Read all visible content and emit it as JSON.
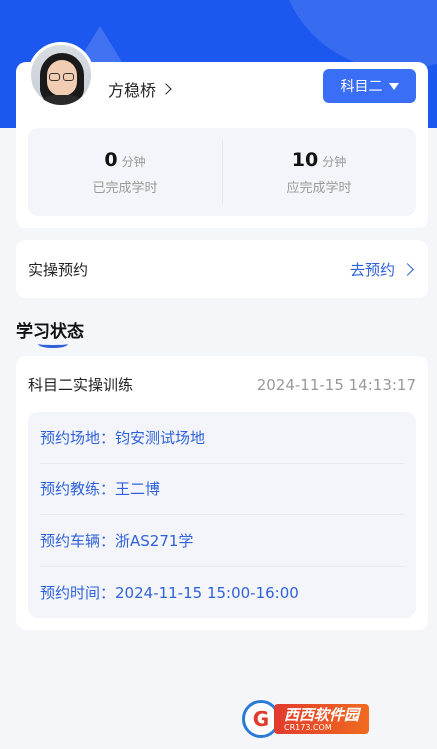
{
  "profile": {
    "name": "方稳桥",
    "subject_button": "科目二"
  },
  "stats": [
    {
      "value": "0",
      "unit": "分钟",
      "label": "已完成学时"
    },
    {
      "value": "10",
      "unit": "分钟",
      "label": "应完成学时"
    }
  ],
  "appointment": {
    "title": "实操预约",
    "link_label": "去预约"
  },
  "section": {
    "title": "学习状态"
  },
  "status": {
    "name": "科目二实操训练",
    "time": "2024-11-15 14:13:17",
    "details": [
      {
        "text": "预约场地：钧安测试场地"
      },
      {
        "text": "预约教练：王二博"
      },
      {
        "text": "预约车辆：浙AS271学"
      },
      {
        "text": "预约时间：2024-11-15 15:00-16:00"
      }
    ]
  },
  "watermark": {
    "logo": "G",
    "text": "西西软件园",
    "sub": "CR173.COM"
  },
  "colors": {
    "header": "#1c58f0",
    "accent": "#3a6ff5",
    "link": "#2f62d8"
  }
}
